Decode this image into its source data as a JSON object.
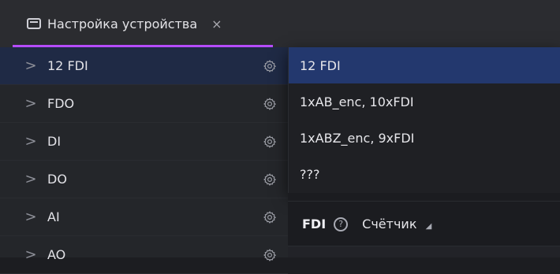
{
  "tab": {
    "icon": "window-icon",
    "title": "Настройка устройства",
    "close": "×"
  },
  "sidebar": {
    "items": [
      {
        "label": "12 FDI",
        "active": true
      },
      {
        "label": "FDO"
      },
      {
        "label": "DI"
      },
      {
        "label": "DO"
      },
      {
        "label": "AI"
      },
      {
        "label": "AO"
      }
    ],
    "chevron": ">"
  },
  "dropdown": {
    "options": [
      {
        "label": "12 FDI",
        "selected": true
      },
      {
        "label": "1xAB_enc, 10xFDI"
      },
      {
        "label": "1xABZ_enc, 9xFDI"
      },
      {
        "label": "???"
      }
    ]
  },
  "panel": {
    "title": "FDI",
    "help_glyph": "?",
    "counter_label": "Счётчик"
  },
  "colors": {
    "accent_underline": "#b64cff",
    "selected_option": "#23386e",
    "active_sidebar": "#1f2a45"
  }
}
